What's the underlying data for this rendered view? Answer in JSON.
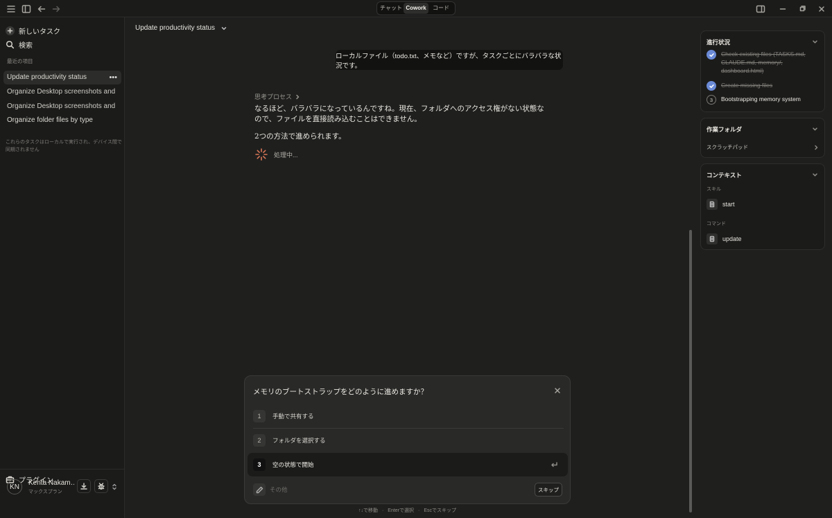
{
  "topbar": {
    "modes": [
      "チャット",
      "Cowork",
      "コード"
    ],
    "active_mode": "Cowork"
  },
  "sidebar": {
    "new_task": "新しいタスク",
    "search": "検索",
    "recents_title": "最近の項目",
    "recents": [
      "Update productivity status",
      "Organize Desktop screenshots and",
      "Organize Desktop screenshots and",
      "Organize folder files by type"
    ],
    "more": "•••",
    "note": "これらのタスクはローカルで実行され、デバイス間で同期されません",
    "plugins": "プラグイン",
    "user": {
      "initials": "KN",
      "name": "Kenta Nakam…",
      "plan": "マックスプラン"
    }
  },
  "main": {
    "task_title": "Update productivity status",
    "user_message": "ローカルファイル（todo.txt、メモなど）ですが、タスクごとにバラバラな状況です。",
    "thinking_label": "思考プロセス",
    "assistant_text": "なるほど、バラバラになっているんですね。現在、フォルダへのアクセス権がない状態なので、ファイルを直接読み込むことはできません。",
    "assistant_line3": "2つの方法で進められます。",
    "processing": "処理中..."
  },
  "question": {
    "title": "メモリのブートストラップをどのように進めますか？",
    "options": [
      {
        "num": "1",
        "label": "手動で共有する"
      },
      {
        "num": "2",
        "label": "フォルダを選択する"
      },
      {
        "num": "3",
        "label": "空の状態で開始"
      }
    ],
    "other_placeholder": "その他",
    "skip": "スキップ",
    "hints": [
      "↑↓で移動",
      "Enterで選択",
      "Escでスキップ"
    ]
  },
  "progress": {
    "title": "進行状況",
    "steps": [
      {
        "text": "Check existing files (TASKS.md, CLAUDE.md, memory/, dashboard.html)",
        "done": true
      },
      {
        "text": "Create missing files",
        "done": true
      },
      {
        "num": "3",
        "text": "Bootstrapping memory system",
        "done": false
      }
    ]
  },
  "folder": {
    "title": "作業フォルダ",
    "item": "スクラッチパッド"
  },
  "context": {
    "title": "コンテキスト",
    "skills_label": "スキル",
    "skill": "start",
    "commands_label": "コマンド",
    "command": "update"
  },
  "colors": {
    "accent": "#6a8ad6",
    "bg": "#1f1f1e",
    "sidebar": "#1b1b1a"
  }
}
